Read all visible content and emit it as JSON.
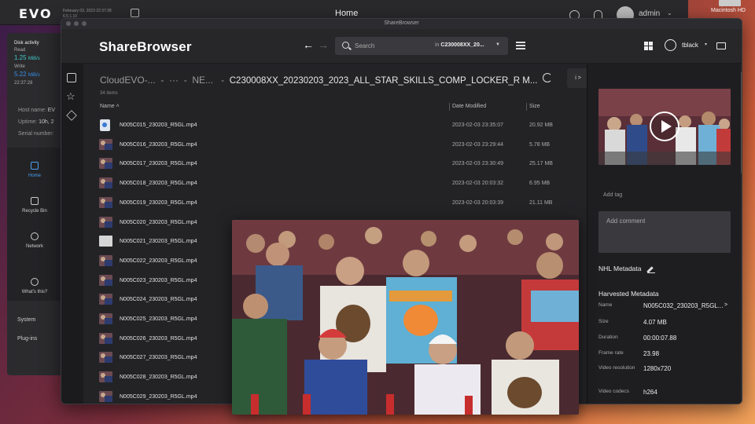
{
  "evo": {
    "logo": "EVO",
    "date_line1": "February 03, 2023 22:37:28",
    "date_line2": "6.5.1.10",
    "title": "Home",
    "user": "admin",
    "disk": {
      "heading": "Disk activity",
      "read_label": "Read",
      "read_value": "1.25",
      "read_unit": "MiB/s",
      "write_label": "Write",
      "write_value": "5.22",
      "write_unit": "MiB/s",
      "time": "22:37:28"
    },
    "info": {
      "host_label": "Host name:",
      "host_value": "EV",
      "uptime_label": "Uptime:",
      "uptime_value": "10h, 2",
      "serial_label": "Serial number:"
    },
    "nav": [
      {
        "label": "Home",
        "active": true
      },
      {
        "label": "Recycle Bin",
        "active": false
      },
      {
        "label": "Network",
        "active": false
      },
      {
        "label": "What's this?",
        "active": false
      }
    ],
    "sections": [
      "System",
      "Plug-ins"
    ]
  },
  "desktop": {
    "drive_label": "Macintosh HD"
  },
  "sharebrowser": {
    "window_title": "ShareBrowser",
    "logo": "ShareBrowser",
    "search_placeholder": "Search",
    "search_scope_prefix": "in",
    "search_scope": "C230008XX_20...",
    "username": "tblack",
    "breadcrumb": {
      "root": "CloudEVO-...",
      "sep": "-",
      "ellipsis": "···",
      "mid": "NE...",
      "current": "C230008XX_20230203_2023_ALL_STAR_SKILLS_COMP_LOCKER_R M..."
    },
    "info_btn": "i >",
    "item_count": "34 items",
    "columns": {
      "name": "Name ˄",
      "date": "Date Modified",
      "size": "Size"
    },
    "rows": [
      {
        "thumb": "doc",
        "name": "N005C015_230203_R5GL.mp4",
        "date": "2023-02-03 23:35:07",
        "size": "20.92 MB"
      },
      {
        "thumb": "img",
        "name": "N005C016_230203_R5GL.mp4",
        "date": "2023-02-03 23:29:44",
        "size": "5.78 MB"
      },
      {
        "thumb": "img",
        "name": "N005C017_230203_R5GL.mp4",
        "date": "2023-02-03 23:30:49",
        "size": "25.17 MB"
      },
      {
        "thumb": "img",
        "name": "N005C018_230203_R5GL.mp4",
        "date": "2023-02-03 20:03:32",
        "size": "6.95 MB"
      },
      {
        "thumb": "img",
        "name": "N005C019_230203_R5GL.mp4",
        "date": "2023-02-03 20:03:39",
        "size": "21.11 MB"
      },
      {
        "thumb": "img",
        "name": "N005C020_230203_R5GL.mp4",
        "date": "",
        "size": ""
      },
      {
        "thumb": "blank",
        "name": "N005C021_230203_R5GL.mp4",
        "date": "",
        "size": ""
      },
      {
        "thumb": "img",
        "name": "N005C022_230203_R5GL.mp4",
        "date": "",
        "size": ""
      },
      {
        "thumb": "img",
        "name": "N005C023_230203_R5GL.mp4",
        "date": "",
        "size": ""
      },
      {
        "thumb": "img",
        "name": "N005C024_230203_R5GL.mp4",
        "date": "",
        "size": ""
      },
      {
        "thumb": "img",
        "name": "N005C025_230203_R5GL.mp4",
        "date": "",
        "size": ""
      },
      {
        "thumb": "img",
        "name": "N005C026_230203_R5GL.mp4",
        "date": "",
        "size": ""
      },
      {
        "thumb": "img",
        "name": "N005C027_230203_R5GL.mp4",
        "date": "",
        "size": ""
      },
      {
        "thumb": "img",
        "name": "N005C028_230203_R5GL.mp4",
        "date": "",
        "size": ""
      },
      {
        "thumb": "img",
        "name": "N005C029_230203_R5GL.mp4",
        "date": "",
        "size": ""
      }
    ],
    "panel": {
      "add_tag": "Add tag",
      "comment_placeholder": "Add comment",
      "nhl_metadata": "NHL Metadata",
      "harvested_metadata": "Harvested Metadata",
      "meta": [
        {
          "key": "Name",
          "value": "N005C032_230203_R5GL...",
          "arrow": ">"
        },
        {
          "key": "Size",
          "value": "4.07 MB"
        },
        {
          "key": "Duration",
          "value": "00:00:07.88"
        },
        {
          "key": "Frame rate",
          "value": "23.98"
        },
        {
          "key": "Video resolution",
          "value": "1280x720"
        },
        {
          "key": "Video codecs",
          "value": "h264"
        }
      ]
    }
  },
  "colors": {
    "accent_blue": "#4a9ff0",
    "teal": "#3fc7c7",
    "window_bg": "#202023"
  }
}
